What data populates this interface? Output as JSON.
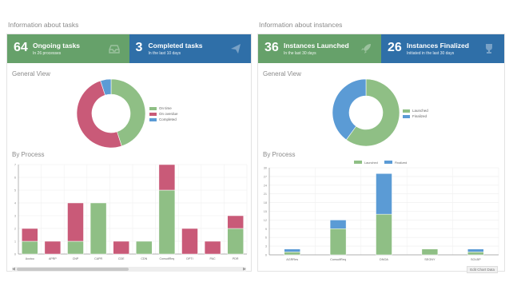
{
  "left": {
    "title": "Information about tasks",
    "kpis": [
      {
        "number": "64",
        "label": "Ongoing tasks",
        "sub": "In 26 processes",
        "color": "#66a16a",
        "icon": "inbox-icon"
      },
      {
        "number": "3",
        "label": "Completed tasks",
        "sub": "In the last 10 days",
        "color": "#2f6fa8",
        "icon": "paper-plane-icon"
      }
    ],
    "general_view_title": "General View",
    "by_process_title": "By Process",
    "donut": {
      "segments": [
        {
          "name": "On time",
          "value": 45,
          "color": "#8fbf85"
        },
        {
          "name": "On overdue",
          "value": 50,
          "color": "#c95a78"
        },
        {
          "name": "Completed",
          "value": 5,
          "color": "#5b9bd5"
        }
      ]
    }
  },
  "right": {
    "title": "Information about instances",
    "kpis": [
      {
        "number": "36",
        "label": "Instances Launched",
        "sub": "In the last 30 days",
        "color": "#66a16a",
        "icon": "rocket-icon"
      },
      {
        "number": "26",
        "label": "Instances Finalized",
        "sub": "Initiated in the last 30 days",
        "color": "#2f6fa8",
        "icon": "trophy-icon"
      }
    ],
    "general_view_title": "General View",
    "by_process_title": "By Process",
    "donut": {
      "segments": [
        {
          "name": "Launched",
          "value": 60,
          "color": "#8fbf85"
        },
        {
          "name": "Finalized",
          "value": 40,
          "color": "#5b9bd5"
        }
      ]
    },
    "edit_button": "Edit Chart Data"
  },
  "chart_data": [
    {
      "type": "bar",
      "stacked": true,
      "categories": [
        "Acctou",
        "APRP",
        "CNP",
        "CAPR",
        "CDE",
        "CDN",
        "ConsultReq",
        "DPTI",
        "PAC",
        "PDR"
      ],
      "series": [
        {
          "name": "On time",
          "color": "#8fbf85",
          "values": [
            1,
            0,
            1,
            4,
            0,
            1,
            5,
            0,
            0,
            2
          ]
        },
        {
          "name": "On overdue",
          "color": "#c95a78",
          "values": [
            1,
            1,
            3,
            0,
            1,
            0,
            2,
            2,
            1,
            1
          ]
        }
      ],
      "ylim": [
        0,
        7
      ],
      "yticks": [
        "0",
        "1",
        "2",
        "3",
        "4",
        "5",
        "6",
        "7"
      ]
    },
    {
      "type": "bar",
      "stacked": true,
      "categories": [
        "AGRRes",
        "ConsultReq",
        "DNOA",
        "SEGNY",
        "SOLBP"
      ],
      "series": [
        {
          "name": "Launched",
          "color": "#8fbf85",
          "values": [
            1,
            9,
            14,
            2,
            1
          ]
        },
        {
          "name": "Finalized",
          "color": "#5b9bd5",
          "values": [
            1,
            3,
            14,
            0,
            1
          ]
        }
      ],
      "ylim": [
        0,
        30
      ],
      "yticks": [
        "0",
        "3",
        "6",
        "9",
        "12",
        "15",
        "18",
        "21",
        "24",
        "27",
        "30"
      ],
      "legend_position": "top-center"
    }
  ]
}
